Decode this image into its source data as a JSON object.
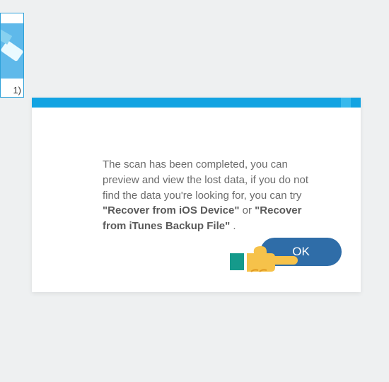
{
  "thumbnail": {
    "caption": "1)"
  },
  "dialog": {
    "message_pre": "The scan has been completed, you can preview and view the lost data, if you do not find the data you're looking for, you can try ",
    "option1": "\"Recover from iOS Device\"",
    "connector": " or ",
    "option2": "\"Recover from iTunes Backup File\"",
    "suffix": ".",
    "ok_label": "OK"
  }
}
